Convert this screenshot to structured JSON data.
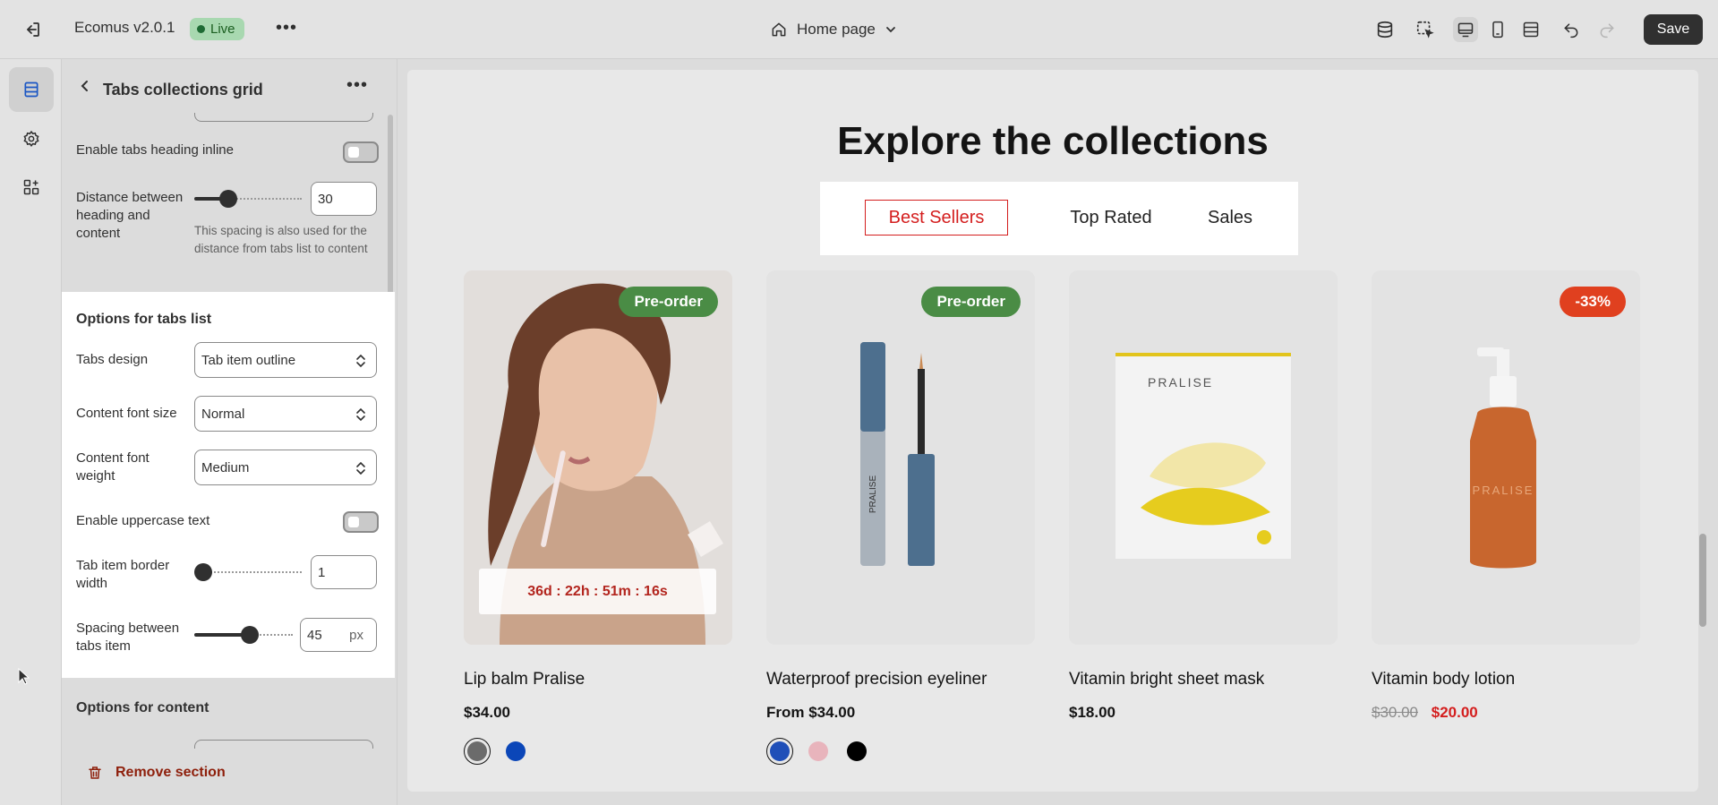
{
  "topbar": {
    "app_title": "Ecomus v2.0.1",
    "live_label": "Live",
    "page_label": "Home page",
    "save_label": "Save",
    "icons": [
      "exit-icon",
      "more-icon",
      "home-icon",
      "chevron-down-icon",
      "database-icon",
      "inspector-icon",
      "desktop-icon",
      "mobile-icon",
      "fullwidth-icon",
      "undo-icon",
      "redo-icon"
    ]
  },
  "rail": {
    "items": [
      "sections-icon",
      "settings-icon",
      "apps-icon"
    ]
  },
  "panel": {
    "title": "Tabs collections grid",
    "enable_heading_inline_label": "Enable tabs heading inline",
    "distance_label": "Distance between heading and content",
    "distance_value": "30",
    "distance_help": "This spacing is also used for the distance from tabs list to content",
    "tabs_list_title": "Options for tabs list",
    "tabs_design_label": "Tabs design",
    "tabs_design_value": "Tab item outline",
    "content_font_size_label": "Content font size",
    "content_font_size_value": "Normal",
    "content_font_weight_label": "Content font weight",
    "content_font_weight_value": "Medium",
    "uppercase_label": "Enable uppercase text",
    "border_width_label": "Tab item border width",
    "border_width_value": "1",
    "spacing_label": "Spacing between tabs item",
    "spacing_value": "45",
    "spacing_unit": "px",
    "content_options_title": "Options for content",
    "remove_label": "Remove section",
    "toggles": {
      "enable_heading_inline": false,
      "enable_uppercase": false
    },
    "sliders": {
      "distance_fraction": 0.3,
      "border_width_fraction": 0.0,
      "spacing_fraction": 0.6
    }
  },
  "preview": {
    "heading": "Explore the collections",
    "tabs": [
      "Best Sellers",
      "Top Rated",
      "Sales"
    ],
    "active_tab": "Best Sellers",
    "products": [
      {
        "name": "Lip balm Pralise",
        "price": "$34.00",
        "badge": "Pre-order",
        "badge_color": "#4a8c45",
        "countdown": "36d : 22h : 51m : 16s",
        "swatches": [
          "#6b6b6b",
          "#0b46b8"
        ]
      },
      {
        "name": "Waterproof precision eyeliner",
        "price": "From $34.00",
        "badge": "Pre-order",
        "badge_color": "#4a8c45",
        "swatches": [
          "#1f4fb8",
          "#e8b4bc",
          "#000000"
        ]
      },
      {
        "name": "Vitamin bright sheet mask",
        "price": "$18.00",
        "brand_text": "PRALISE"
      },
      {
        "name": "Vitamin body lotion",
        "old_price": "$30.00",
        "new_price": "$20.00",
        "badge": "-33%",
        "badge_color": "#e0401f",
        "brand_text": "PRALISE"
      }
    ],
    "eyeliner_brand": "PRALISE"
  },
  "colors": {
    "accent_red": "#d41e1e",
    "save_bg": "#303030",
    "live_green": "#a8d8b0"
  }
}
